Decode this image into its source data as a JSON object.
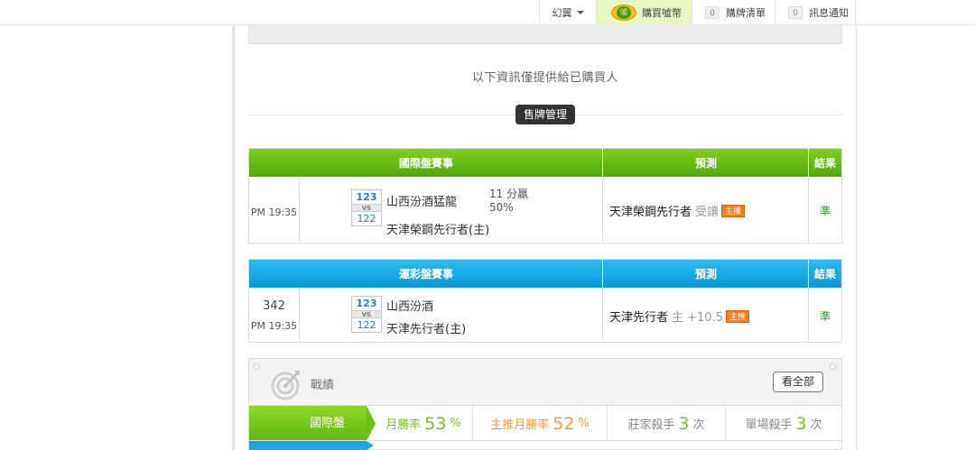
{
  "nav": {
    "user_name": "幻翼",
    "buy_coins": "購買噓幣",
    "coin_glyph": "噓",
    "list_count": "0",
    "list_label": "購牌清單",
    "notice_count": "0",
    "notice_label": "訊息通知"
  },
  "notice_text": "以下資訊僅提供給已購買人",
  "manage_button": "售牌管理",
  "international": {
    "header": {
      "event": "國際盤賽事",
      "prediction": "預測",
      "result": "結果"
    },
    "row": {
      "time": "PM 19:35",
      "home_score": "123",
      "vs": "VS",
      "away_score": "122",
      "home_team": "山西汾酒猛龍",
      "away_team": "天津榮鋼先行者(主)",
      "spread": "11 分贏",
      "percent": "50%",
      "pick": "天津榮鋼先行者",
      "pick_note": "受讓",
      "tag": "主推",
      "result": "準"
    }
  },
  "lottery": {
    "header": {
      "event": "運彩盤賽事",
      "prediction": "預測",
      "result": "結果"
    },
    "row": {
      "number": "342",
      "time": "PM 19:35",
      "home_score": "123",
      "vs": "VS",
      "away_score": "122",
      "home_team": "山西汾酒",
      "away_team": "天津先行者(主)",
      "pick": "天津先行者",
      "pick_note": "主 +10.5",
      "tag": "主推",
      "result": "準"
    }
  },
  "record": {
    "title": "戰績",
    "view_all": "看全部",
    "label": "國際盤",
    "monthly_win_label": "月勝率",
    "monthly_win_value": "53",
    "monthly_win_unit": "%",
    "main_win_label": "主推月勝率",
    "main_win_value": "52",
    "main_win_unit": "%",
    "banker_label": "莊家殺手",
    "banker_value": "3",
    "banker_unit": "次",
    "single_label": "單場殺手",
    "single_value": "3",
    "single_unit": "次"
  },
  "colors": {
    "green_header": "#62b712",
    "blue_header": "#0c99d6",
    "accent_orange": "#f07e1d",
    "result_green": "#2a9d2a"
  }
}
